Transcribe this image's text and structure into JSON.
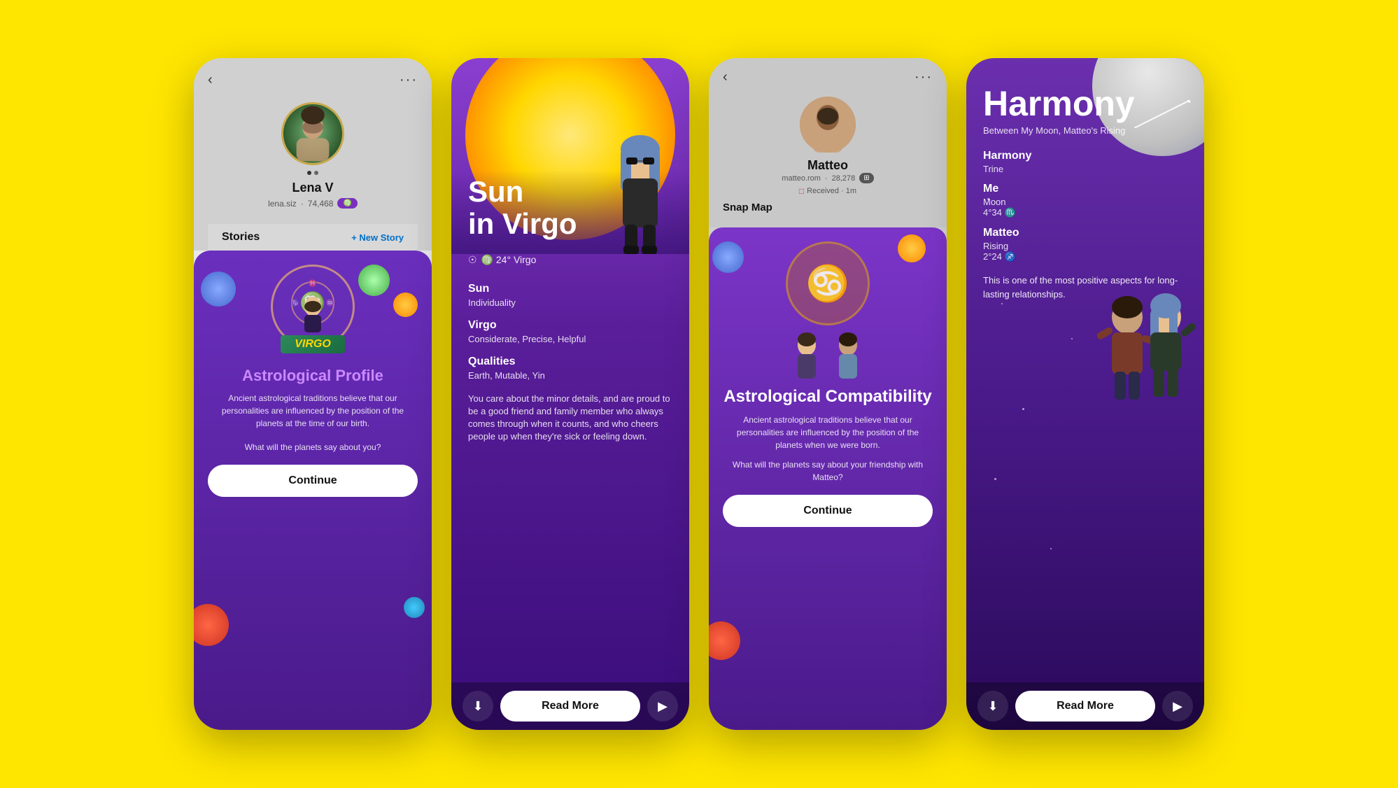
{
  "background_color": "#FFE600",
  "screens": [
    {
      "id": "screen1",
      "type": "profile",
      "header": {
        "chevron": "‹",
        "dots": "···"
      },
      "user": {
        "name": "Lena V",
        "handle": "lena.siz",
        "score": "74,468",
        "zodiac_badge": "♍"
      },
      "stories_label": "Stories",
      "new_story_label": "+ New Story",
      "astro_card": {
        "sign": "VIRGO",
        "title": "Astrological Profile",
        "description": "Ancient astrological traditions believe that our personalities are influenced by the position of the planets at the time of our birth.",
        "question": "What will the planets say about you?",
        "button_label": "Continue"
      }
    },
    {
      "id": "screen2",
      "type": "sun_in_virgo",
      "title_line1": "Sun",
      "title_line2": "in Virgo",
      "sun_symbol": "☉",
      "sun_degree": "♍ 24° Virgo",
      "sections": [
        {
          "title": "Sun",
          "text": "Individuality"
        },
        {
          "title": "Virgo",
          "text": "Considerate, Precise, Helpful"
        },
        {
          "title": "Qualities",
          "text": "Earth, Mutable, Yin"
        }
      ],
      "description": "You care about the minor details, and are proud to be a good friend and family member who always comes through when it counts, and who cheers people up when they're sick or feeling down.",
      "buttons": {
        "download": "⬇",
        "read_more": "Read More",
        "forward": "▶"
      }
    },
    {
      "id": "screen3",
      "type": "compatibility",
      "header": {
        "chevron": "‹",
        "dots": "···"
      },
      "friend": {
        "name": "Matteo",
        "handle": "matteo.rom",
        "score": "28,278",
        "received_label": "Received · 1m"
      },
      "snap_map_label": "Snap Map",
      "compat_card": {
        "title": "Astrological Compatibility",
        "description": "Ancient astrological traditions believe that our personalities are influenced by the position of the planets when we were born.",
        "question": "What will the planets say about your friendship with Matteo?",
        "button_label": "Continue"
      }
    },
    {
      "id": "screen4",
      "type": "harmony",
      "title": "Harmony",
      "subtitle": "Between My Moon, Matteo's Rising",
      "sections": [
        {
          "label": "Harmony",
          "value": "Trine"
        },
        {
          "label": "Me",
          "value": "Moon\n4°34 ♏"
        },
        {
          "label": "Matteo",
          "value": "Rising\n2°24 ♐"
        }
      ],
      "description": "This is one of the most positive aspects for long-lasting relationships.",
      "buttons": {
        "download": "⬇",
        "read_more": "Read More",
        "forward": "▶"
      }
    }
  ]
}
